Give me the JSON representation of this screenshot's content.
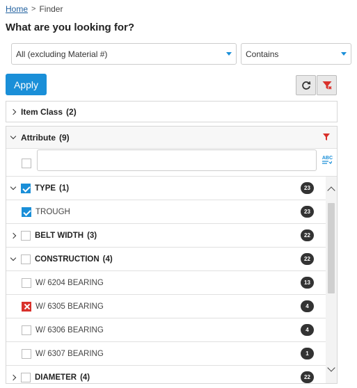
{
  "breadcrumb": {
    "home": "Home",
    "separator": ">",
    "current": "Finder"
  },
  "page": {
    "title": "What are you looking for?"
  },
  "filters": {
    "scope_value": "All (excluding Material #)",
    "match_value": "Contains",
    "apply_label": "Apply"
  },
  "colors": {
    "accent": "#1a8fd8",
    "exclude": "#d9312b",
    "badge": "#333333"
  },
  "item_class": {
    "label": "Item Class",
    "count": "(2)"
  },
  "attribute": {
    "label": "Attribute",
    "count": "(9)",
    "search_value": "",
    "abc_icon_text": "ABC",
    "groups": [
      {
        "label": "TYPE",
        "count": "(1)",
        "expanded": true,
        "checked": true,
        "badge": "23"
      },
      {
        "label": "TROUGH",
        "child": true,
        "checked": true,
        "badge": "23"
      },
      {
        "label": "BELT WIDTH",
        "count": "(3)",
        "expanded": false,
        "badge": "22"
      },
      {
        "label": "CONSTRUCTION",
        "count": "(4)",
        "expanded": true,
        "badge": "22"
      },
      {
        "label": "W/ 6204 BEARING",
        "child": true,
        "badge": "13"
      },
      {
        "label": "W/ 6305 BEARING",
        "child": true,
        "excluded": true,
        "badge": "4"
      },
      {
        "label": "W/ 6306 BEARING",
        "child": true,
        "badge": "4"
      },
      {
        "label": "W/ 6307 BEARING",
        "child": true,
        "badge": "1"
      },
      {
        "label": "DIAMETER",
        "count": "(4)",
        "expanded": false,
        "badge": "22"
      }
    ]
  }
}
